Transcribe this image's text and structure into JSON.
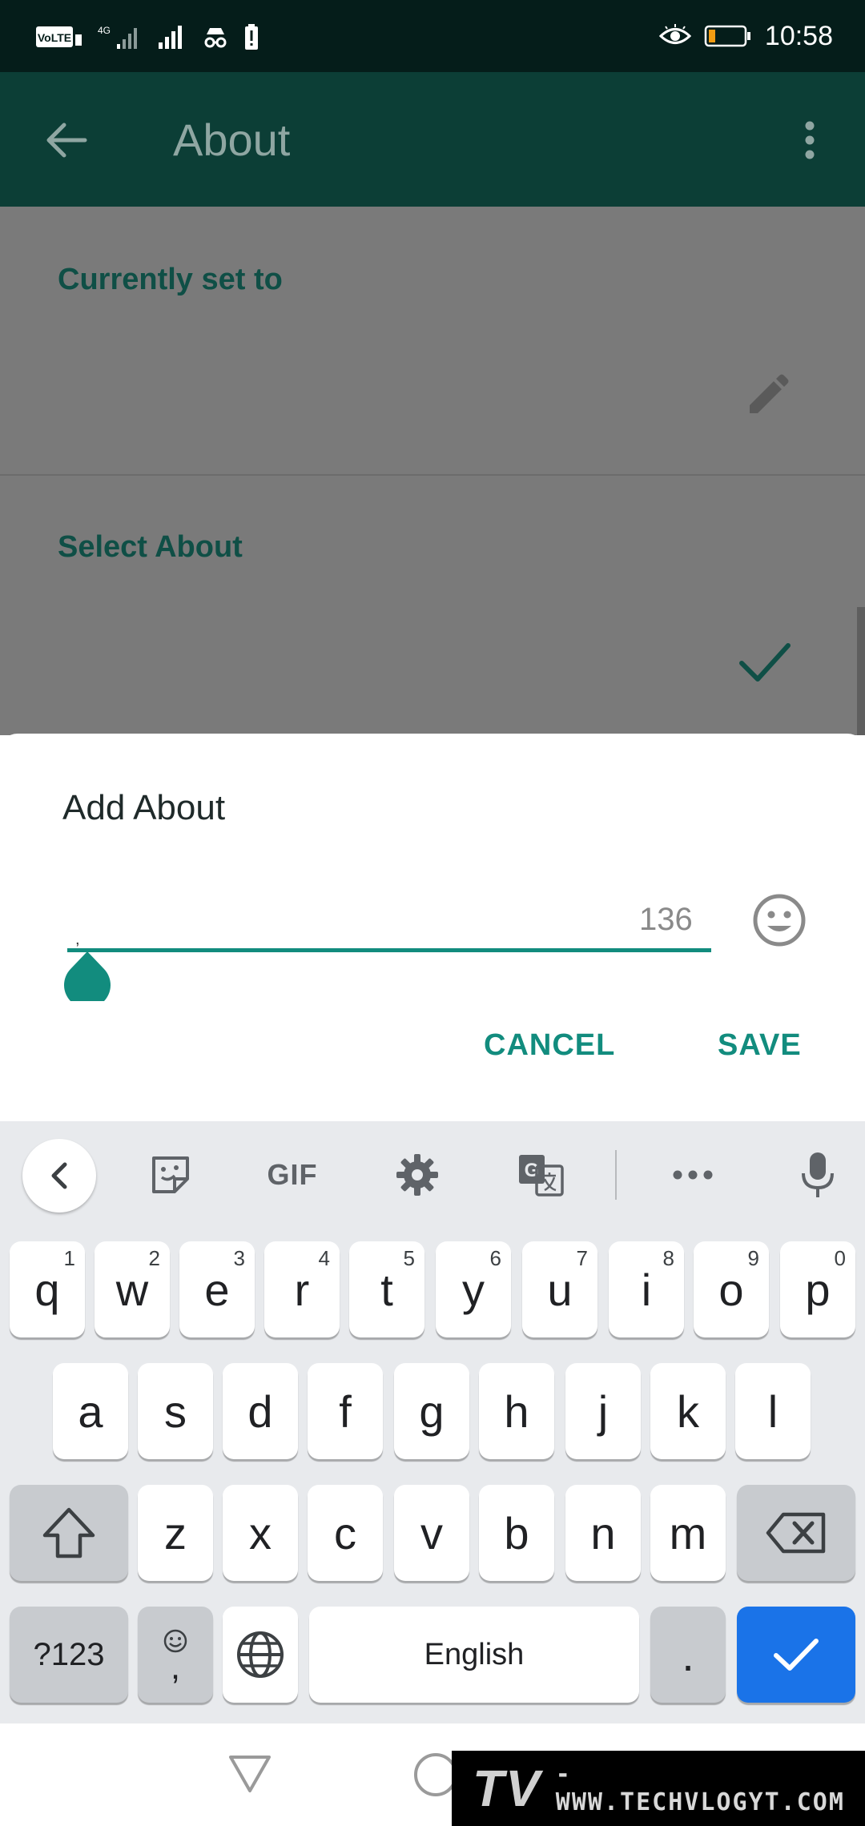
{
  "status_bar": {
    "network_badge": "VoLTE",
    "network_type": "4G",
    "time": "10:58"
  },
  "app_bar": {
    "title": "About"
  },
  "sections": {
    "currently_set_to": "Currently set to",
    "select_about": "Select About"
  },
  "dialog": {
    "title": "Add About",
    "input_value": ",",
    "char_count": "136",
    "cancel_label": "CANCEL",
    "save_label": "SAVE"
  },
  "keyboard": {
    "toolbar": {
      "gif_label": "GIF"
    },
    "row1": [
      {
        "label": "q",
        "hint": "1"
      },
      {
        "label": "w",
        "hint": "2"
      },
      {
        "label": "e",
        "hint": "3"
      },
      {
        "label": "r",
        "hint": "4"
      },
      {
        "label": "t",
        "hint": "5"
      },
      {
        "label": "y",
        "hint": "6"
      },
      {
        "label": "u",
        "hint": "7"
      },
      {
        "label": "i",
        "hint": "8"
      },
      {
        "label": "o",
        "hint": "9"
      },
      {
        "label": "p",
        "hint": "0"
      }
    ],
    "row2": [
      "a",
      "s",
      "d",
      "f",
      "g",
      "h",
      "j",
      "k",
      "l"
    ],
    "row3": [
      "z",
      "x",
      "c",
      "v",
      "b",
      "n",
      "m"
    ],
    "symbols_label": "?123",
    "comma_label": ",",
    "space_label": "English",
    "period_label": "."
  },
  "watermark": {
    "logo": "TV",
    "url": "- WWW.TECHVLOGYT.COM"
  },
  "colors": {
    "accent": "#128c7e",
    "app_bar": "#0c3e36",
    "status_bar": "#051d1a",
    "enter_key": "#1a73e8"
  }
}
